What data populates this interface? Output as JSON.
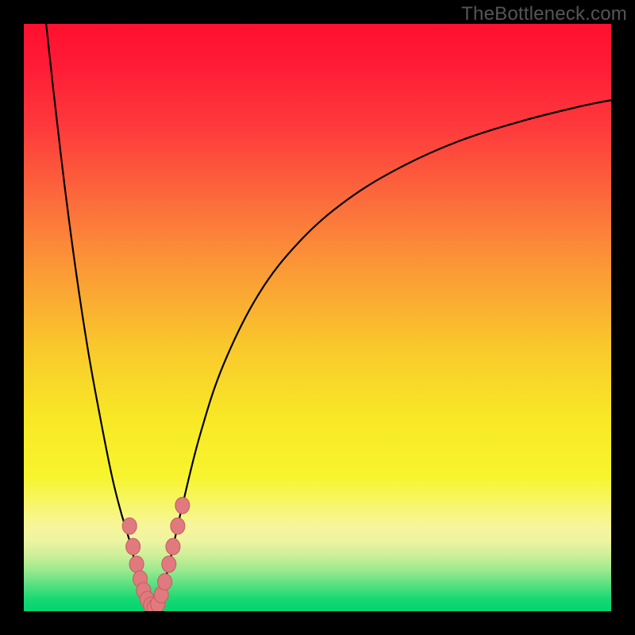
{
  "watermark": "TheBottleneck.com",
  "colors": {
    "frame": "#000000",
    "curve": "#000000",
    "marker_fill": "#E07A7F",
    "marker_stroke": "#C35C60",
    "grad_stops": [
      {
        "offset": 0.0,
        "color": "#FF102F"
      },
      {
        "offset": 0.07,
        "color": "#FF1B36"
      },
      {
        "offset": 0.18,
        "color": "#FE3B3C"
      },
      {
        "offset": 0.3,
        "color": "#FC6B3C"
      },
      {
        "offset": 0.42,
        "color": "#FB9A36"
      },
      {
        "offset": 0.55,
        "color": "#F9C82C"
      },
      {
        "offset": 0.67,
        "color": "#F8E826"
      },
      {
        "offset": 0.77,
        "color": "#F7F42D"
      },
      {
        "offset": 0.8,
        "color": "#F7F653"
      },
      {
        "offset": 0.83,
        "color": "#F7F67B"
      },
      {
        "offset": 0.855,
        "color": "#F7F59B"
      },
      {
        "offset": 0.88,
        "color": "#EEF4A1"
      },
      {
        "offset": 0.905,
        "color": "#CDEF99"
      },
      {
        "offset": 0.93,
        "color": "#9BE98F"
      },
      {
        "offset": 0.955,
        "color": "#59E081"
      },
      {
        "offset": 0.98,
        "color": "#16D874"
      },
      {
        "offset": 1.0,
        "color": "#03D56F"
      }
    ]
  },
  "chart_data": {
    "type": "line",
    "title": "",
    "xlabel": "",
    "ylabel": "",
    "xlim": [
      0,
      100
    ],
    "ylim": [
      0,
      100
    ],
    "grid": false,
    "series": [
      {
        "name": "left-branch",
        "x": [
          3.8,
          5,
          7,
          9,
          11,
          13,
          15,
          16.5,
          18,
          19,
          19.8,
          20.5,
          21,
          21.5,
          22
        ],
        "y": [
          100,
          89,
          72,
          57,
          44,
          33,
          23,
          17,
          12,
          8,
          5.5,
          3.5,
          2.2,
          1.2,
          0.5
        ]
      },
      {
        "name": "right-branch",
        "x": [
          22,
          23,
          24.5,
          27,
          30,
          34,
          40,
          47,
          55,
          64,
          74,
          85,
          95,
          100
        ],
        "y": [
          0.5,
          2,
          7,
          18,
          30,
          42,
          54,
          63,
          70,
          75.5,
          80,
          83.5,
          86,
          87
        ]
      }
    ],
    "markers": {
      "name": "highlight-points",
      "points": [
        {
          "x": 18.0,
          "y": 14.5
        },
        {
          "x": 18.6,
          "y": 11.0
        },
        {
          "x": 19.2,
          "y": 8.0
        },
        {
          "x": 19.8,
          "y": 5.5
        },
        {
          "x": 20.4,
          "y": 3.5
        },
        {
          "x": 21.0,
          "y": 2.0
        },
        {
          "x": 21.6,
          "y": 1.0
        },
        {
          "x": 22.2,
          "y": 0.6
        },
        {
          "x": 22.8,
          "y": 1.2
        },
        {
          "x": 23.4,
          "y": 2.8
        },
        {
          "x": 24.0,
          "y": 5.0
        },
        {
          "x": 24.7,
          "y": 8.0
        },
        {
          "x": 25.4,
          "y": 11.0
        },
        {
          "x": 26.2,
          "y": 14.5
        },
        {
          "x": 27.0,
          "y": 18.0
        }
      ],
      "radius": 9
    },
    "annotations": []
  }
}
